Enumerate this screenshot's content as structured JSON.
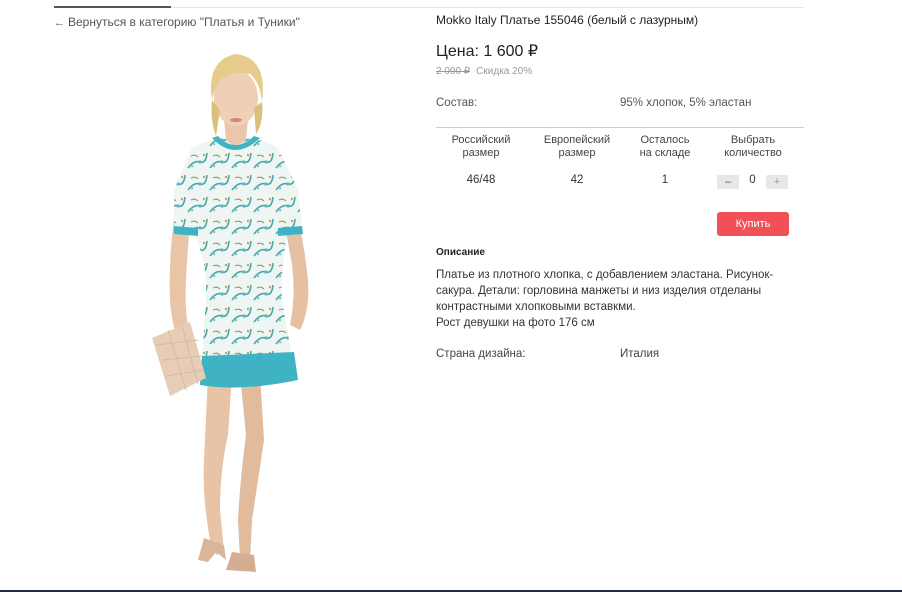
{
  "nav": {
    "back_arrow": "←",
    "back_link": "Вернуться в категорию \"Платья и Туники\""
  },
  "product": {
    "title": "Mokko Italy Платье 155046 (белый с лазурным)",
    "price_label": "Цена: 1 600 ₽",
    "old_price": "2 000 ₽",
    "discount": "Скидка 20%",
    "composition_label": "Состав:",
    "composition_value": "95% хлопок, 5% эластан",
    "image_icon": "dress-model-photo"
  },
  "sizes_table": {
    "headers": [
      [
        "Российский",
        "размер"
      ],
      [
        "Европейский",
        "размер"
      ],
      [
        "Осталось",
        "на складе"
      ],
      [
        "Выбрать",
        "количество"
      ]
    ],
    "row": {
      "ru_size": "46/48",
      "eu_size": "42",
      "stock": "1",
      "quantity": "0",
      "minus": "–",
      "plus": "+"
    }
  },
  "buy_button": "Купить",
  "description": {
    "heading": "Описание",
    "lines": [
      "Платье из плотного хлопка, с добавлением эластана. Рисунок-",
      "сакура. Детали: горловина манжеты и низ изделия отделаны",
      "контрастными хлопковыми вставкми.",
      "Рост девушки на фото 176 см"
    ]
  },
  "design_country": {
    "label": "Страна дизайна:",
    "value": "Италия"
  },
  "colors": {
    "accent_red": "#f25057",
    "dress_trim": "#3fb3c4",
    "dress_base": "#eef5f3"
  }
}
